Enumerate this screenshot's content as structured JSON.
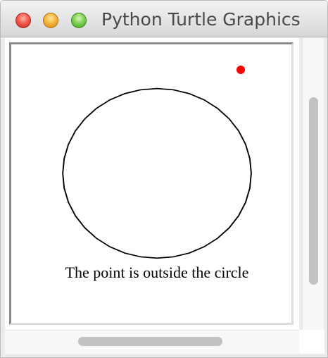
{
  "window": {
    "title": "Python Turtle Graphics"
  },
  "canvas": {
    "message": "The point is outside the circle",
    "circle_color": "#000000",
    "point_color": "#ff0000"
  }
}
